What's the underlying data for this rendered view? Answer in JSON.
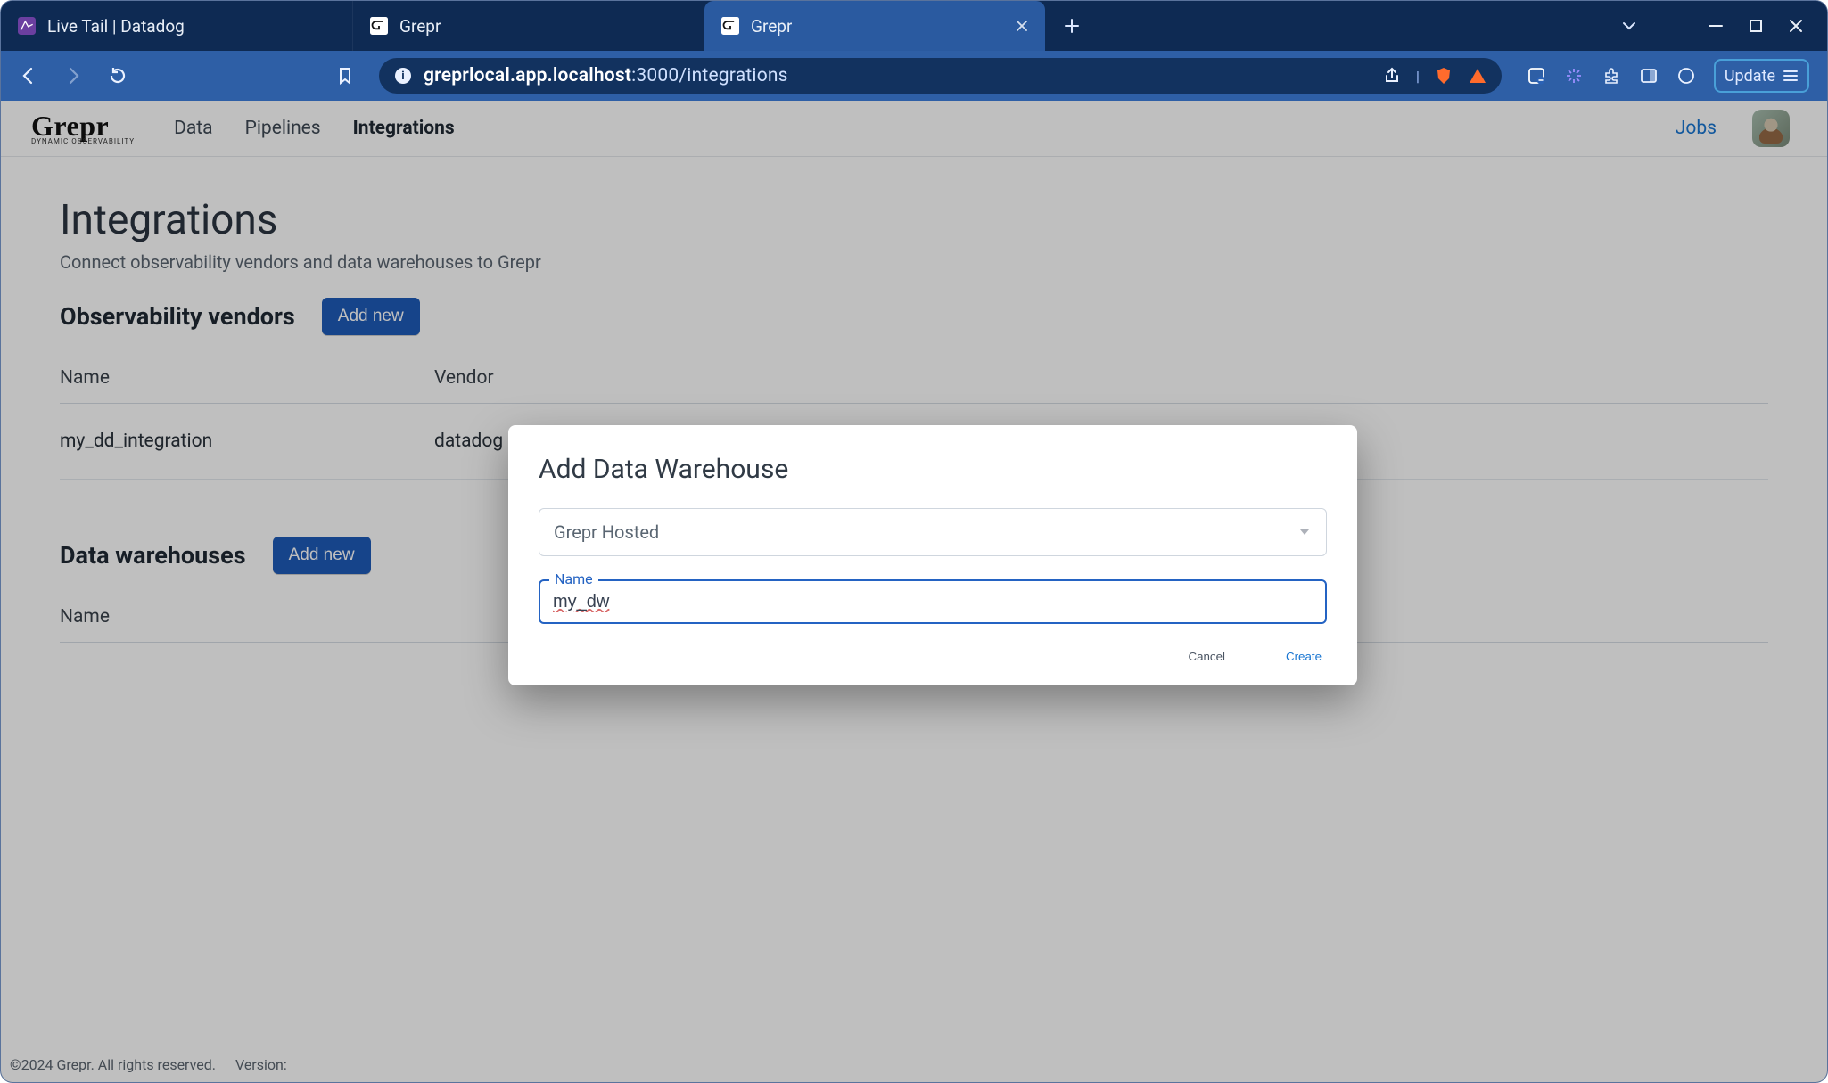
{
  "browser": {
    "tabs": [
      {
        "title": "Live Tail | Datadog"
      },
      {
        "title": "Grepr"
      },
      {
        "title": "Grepr"
      }
    ],
    "url_domain": "greprlocal.app.localhost",
    "url_port": ":3000",
    "url_path": "/integrations",
    "update_label": "Update"
  },
  "app": {
    "logo_top": "Grepr",
    "logo_sub": "DYNAMIC OBSERVABILITY",
    "nav": {
      "data": "Data",
      "pipelines": "Pipelines",
      "integrations": "Integrations"
    },
    "jobs_link": "Jobs"
  },
  "page": {
    "title": "Integrations",
    "subtitle": "Connect observability vendors and data warehouses to Grepr"
  },
  "vendors": {
    "title": "Observability vendors",
    "add_label": "Add new",
    "columns": {
      "name": "Name",
      "vendor": "Vendor"
    },
    "rows": [
      {
        "name": "my_dd_integration",
        "vendor": "datadog"
      }
    ]
  },
  "warehouses": {
    "title": "Data warehouses",
    "add_label": "Add new",
    "columns": {
      "name": "Name"
    }
  },
  "modal": {
    "title": "Add Data Warehouse",
    "select_value": "Grepr Hosted",
    "name_label": "Name",
    "name_value": "my_dw",
    "cancel": "Cancel",
    "create": "Create"
  },
  "footer": {
    "copyright": "©2024 Grepr. All rights reserved.",
    "version_label": "Version:"
  }
}
